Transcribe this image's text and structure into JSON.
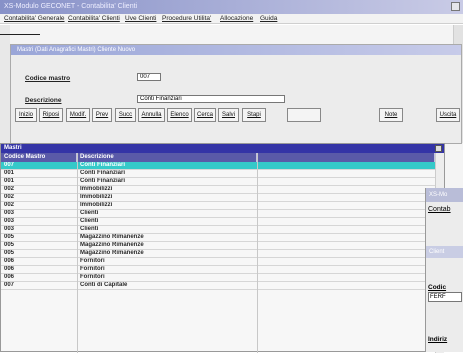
{
  "window": {
    "title": "XS-Modulo GECONET - Contabilita' Clienti"
  },
  "menu": [
    "Contabilita' Generale",
    "Contabilita' Clienti",
    "Uve Clienti",
    "Procedure Utilita'",
    "Allocazione",
    "Guida"
  ],
  "form": {
    "title": "Mastri (Dati Anagrafici Mastri)   Cliente Nuovo",
    "fields": {
      "codice_label": "Codice mastro",
      "codice_value": "007",
      "descrizione_label": "Descrizione",
      "descrizione_value": "Conti Finanziari"
    },
    "buttons": [
      "Inizio",
      "Riposi",
      "Modif.",
      "Prev",
      "Succ",
      "Annulla",
      "Elenco",
      "Cerca",
      "Salvi",
      "Stapi",
      "",
      "Note",
      "Uscita"
    ]
  },
  "list": {
    "title": "Mastri",
    "columns": [
      "Codice Mastro",
      "Descrizione",
      ""
    ],
    "rows": [
      {
        "code": "007",
        "desc": "Conti Finanziari",
        "selected": true
      },
      {
        "code": "001",
        "desc": "Conti Finanziari",
        "selected": false
      },
      {
        "code": "001",
        "desc": "Conti Finanziari",
        "selected": false
      },
      {
        "code": "002",
        "desc": "Immobilizzi",
        "selected": false
      },
      {
        "code": "002",
        "desc": "Immobilizzi",
        "selected": false
      },
      {
        "code": "002",
        "desc": "Immobilizzi",
        "selected": false
      },
      {
        "code": "003",
        "desc": "Clienti",
        "selected": false
      },
      {
        "code": "003",
        "desc": "Clienti",
        "selected": false
      },
      {
        "code": "003",
        "desc": "Clienti",
        "selected": false
      },
      {
        "code": "005",
        "desc": "Magazzino Rimanenze",
        "selected": false
      },
      {
        "code": "005",
        "desc": "Magazzino Rimanenze",
        "selected": false
      },
      {
        "code": "005",
        "desc": "Magazzino Rimanenze",
        "selected": false
      },
      {
        "code": "006",
        "desc": "Fornitori",
        "selected": false
      },
      {
        "code": "006",
        "desc": "Fornitori",
        "selected": false
      },
      {
        "code": "006",
        "desc": "Fornitori",
        "selected": false
      },
      {
        "code": "007",
        "desc": "Conti di Capitale",
        "selected": false
      }
    ]
  },
  "window2": {
    "title": "XS-Mo",
    "menu": "Contab",
    "subtitle": "Client",
    "field1_label": "Codic",
    "field1_value": "FERF",
    "field2_label": "Indiriz"
  }
}
